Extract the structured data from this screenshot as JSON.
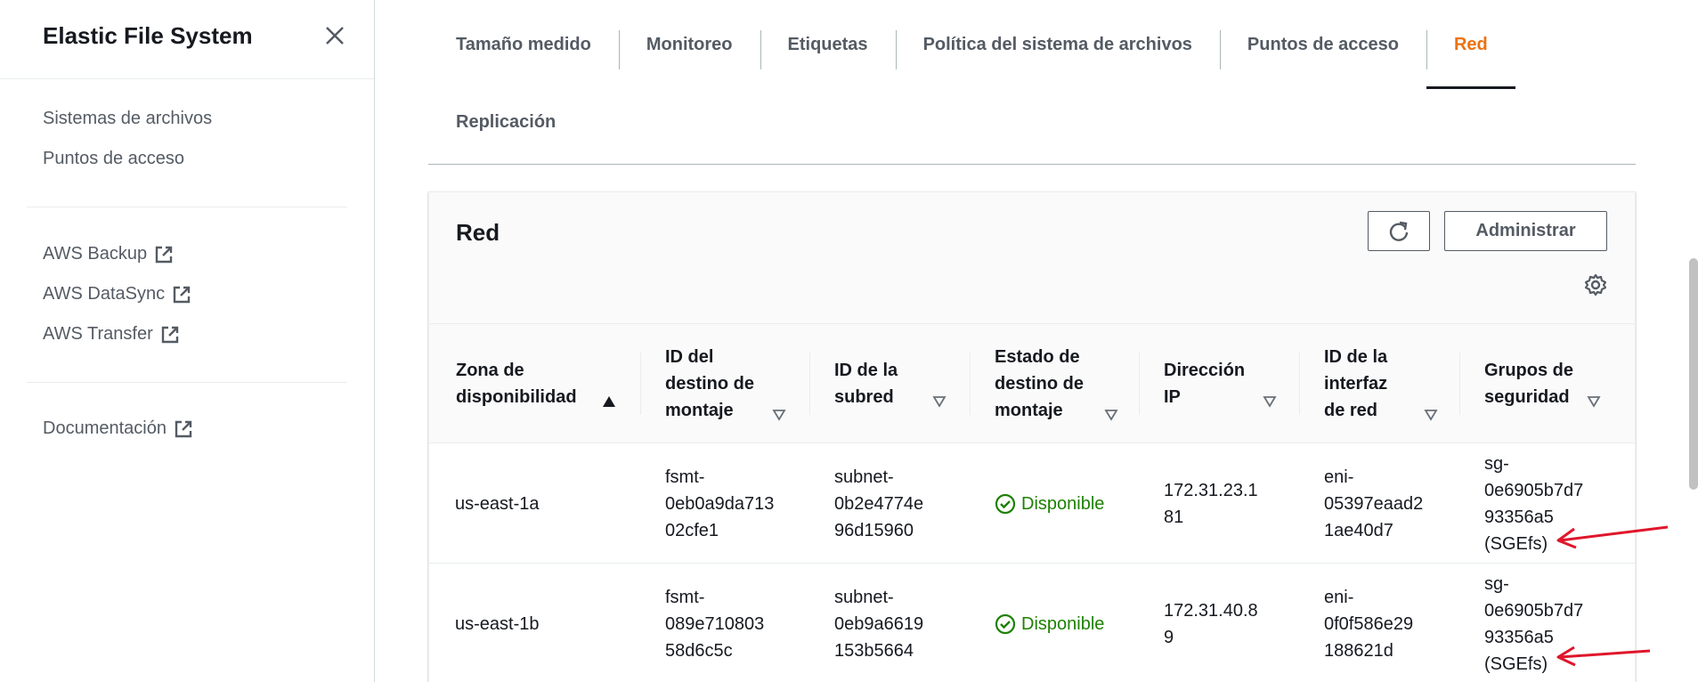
{
  "sidebar": {
    "title": "Elastic File System",
    "nav": [
      "Sistemas de archivos",
      "Puntos de acceso"
    ],
    "external": [
      "AWS Backup",
      "AWS DataSync",
      "AWS Transfer"
    ],
    "docs": "Documentación"
  },
  "tabs": [
    "Tamaño medido",
    "Monitoreo",
    "Etiquetas",
    "Política del sistema de archivos",
    "Puntos de acceso",
    "Red"
  ],
  "tab_second_row": "Replicación",
  "active_tab": "Red",
  "panel": {
    "title": "Red",
    "manage_label": "Administrar"
  },
  "table": {
    "headers": [
      [
        "Zona de",
        "disponibilidad"
      ],
      [
        "ID del",
        "destino de",
        "montaje"
      ],
      [
        "ID de la",
        "subred"
      ],
      [
        "Estado de",
        "destino de",
        "montaje"
      ],
      [
        "Dirección",
        "IP"
      ],
      [
        "ID de la",
        "interfaz",
        "de red"
      ],
      [
        "Grupos de",
        "seguridad"
      ]
    ],
    "rows": [
      {
        "az": "us-east-1a",
        "mount_target": [
          "fsmt-",
          "0eb0a9da713",
          "02cfe1"
        ],
        "subnet": [
          "subnet-",
          "0b2e4774e",
          "96d15960"
        ],
        "status": "Disponible",
        "ip": [
          "172.31.23.1",
          "81"
        ],
        "eni": [
          "eni-",
          "05397eaad2",
          "1ae40d7"
        ],
        "sg": [
          "sg-",
          "0e6905b7d7",
          "93356a5",
          "(SGEfs)"
        ]
      },
      {
        "az": "us-east-1b",
        "mount_target": [
          "fsmt-",
          "089e710803",
          "58d6c5c"
        ],
        "subnet": [
          "subnet-",
          "0eb9a6619",
          "153b5664"
        ],
        "status": "Disponible",
        "ip": [
          "172.31.40.8",
          "9"
        ],
        "eni": [
          "eni-",
          "0f0f586e29",
          "188621d"
        ],
        "sg": [
          "sg-",
          "0e6905b7d7",
          "93356a5",
          "(SGEfs)"
        ]
      }
    ]
  },
  "colors": {
    "accent": "#ec7211",
    "success": "#1d8102",
    "annotation": "#e0162b"
  }
}
